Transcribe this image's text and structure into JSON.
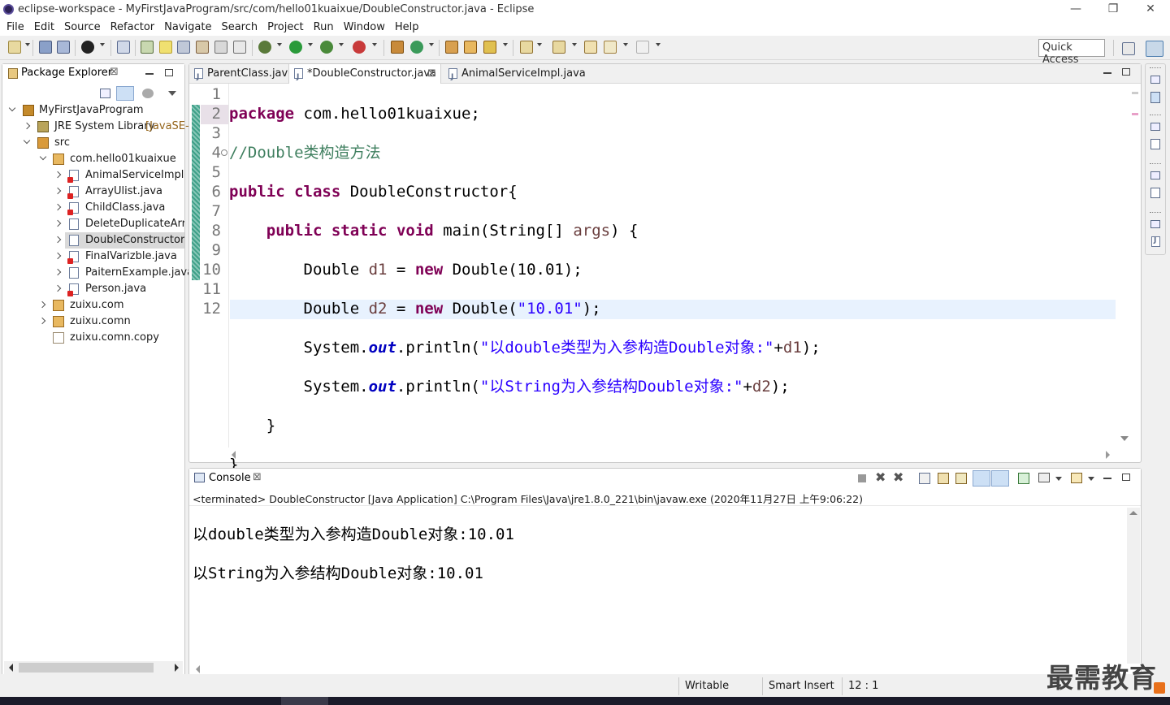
{
  "window": {
    "title": "eclipse-workspace - MyFirstJavaProgram/src/com/hello01kuaixue/DoubleConstructor.java - Eclipse",
    "min": "—",
    "max": "❐",
    "close": "✕"
  },
  "menu": [
    "File",
    "Edit",
    "Source",
    "Refactor",
    "Navigate",
    "Search",
    "Project",
    "Run",
    "Window",
    "Help"
  ],
  "quick_access": "Quick Access",
  "package_explorer": {
    "tab": "Package Explorer",
    "tab_close": "⊠",
    "items": [
      {
        "label": "MyFirstJavaProgram"
      },
      {
        "label": "JRE System Library",
        "suffix": "[JavaSE-"
      },
      {
        "label": "src"
      },
      {
        "label": "com.hello01kuaixue"
      },
      {
        "label": "AnimalServiceImpl.ja"
      },
      {
        "label": "ArrayUlist.java"
      },
      {
        "label": "ChildClass.java"
      },
      {
        "label": "DeleteDuplicateArray"
      },
      {
        "label": "DoubleConstructor.ja"
      },
      {
        "label": "FinalVarizble.java"
      },
      {
        "label": "PaiternExample.java"
      },
      {
        "label": "Person.java"
      },
      {
        "label": "zuixu.com"
      },
      {
        "label": "zuixu.comn"
      },
      {
        "label": "zuixu.comn.copy"
      }
    ]
  },
  "editor": {
    "tabs": [
      {
        "label": "ParentClass.java"
      },
      {
        "label": "*DoubleConstructor.java",
        "close": "⊠"
      },
      {
        "label": "AnimalServiceImpl.java"
      }
    ],
    "line_numbers": [
      "1",
      "2",
      "3",
      "4",
      "5",
      "6",
      "7",
      "8",
      "9",
      "10",
      "11",
      "12"
    ],
    "code": {
      "l1_kw": "package",
      "l1_rest": " com.hello01kuaixue;",
      "l2": "//Double类构造方法",
      "l3_kw1": "public",
      "l3_kw2": "class",
      "l3_rest": " DoubleConstructor{",
      "l4_indent": "    ",
      "l4_kw1": "public",
      "l4_kw2": "static",
      "l4_kw3": "void",
      "l4_mid": " main(String[] ",
      "l4_var": "args",
      "l4_end": ") {",
      "l5_a": "        Double ",
      "l5_var": "d1",
      "l5_b": " = ",
      "l5_kw": "new",
      "l5_c": " Double(10.01);",
      "l6_a": "        Double ",
      "l6_var": "d2",
      "l6_b": " = ",
      "l6_kw": "new",
      "l6_c": " Double(",
      "l6_str": "\"10.01\"",
      "l6_d": ");",
      "l7_a": "        System.",
      "l7_fld": "out",
      "l7_b": ".println(",
      "l7_str": "\"以double类型为入参构造Double对象:\"",
      "l7_c": "+",
      "l7_var": "d1",
      "l7_d": ");",
      "l8_a": "        System.",
      "l8_fld": "out",
      "l8_b": ".println(",
      "l8_str": "\"以String为入参结构Double对象:\"",
      "l8_c": "+",
      "l8_var": "d2",
      "l8_d": ");",
      "l9": "    }",
      "l10": "}"
    }
  },
  "console": {
    "tab": "Console",
    "tab_close": "⊠",
    "status": "<terminated> DoubleConstructor [Java Application] C:\\Program Files\\Java\\jre1.8.0_221\\bin\\javaw.exe (2020年11月27日 上午9:06:22)",
    "lines": [
      "以double类型为入参构造Double对象:10.01",
      "以String为入参结构Double对象:10.01"
    ]
  },
  "status": {
    "writable": "Writable",
    "insert": "Smart Insert",
    "position": "12 : 1"
  },
  "watermark": "最需教育"
}
